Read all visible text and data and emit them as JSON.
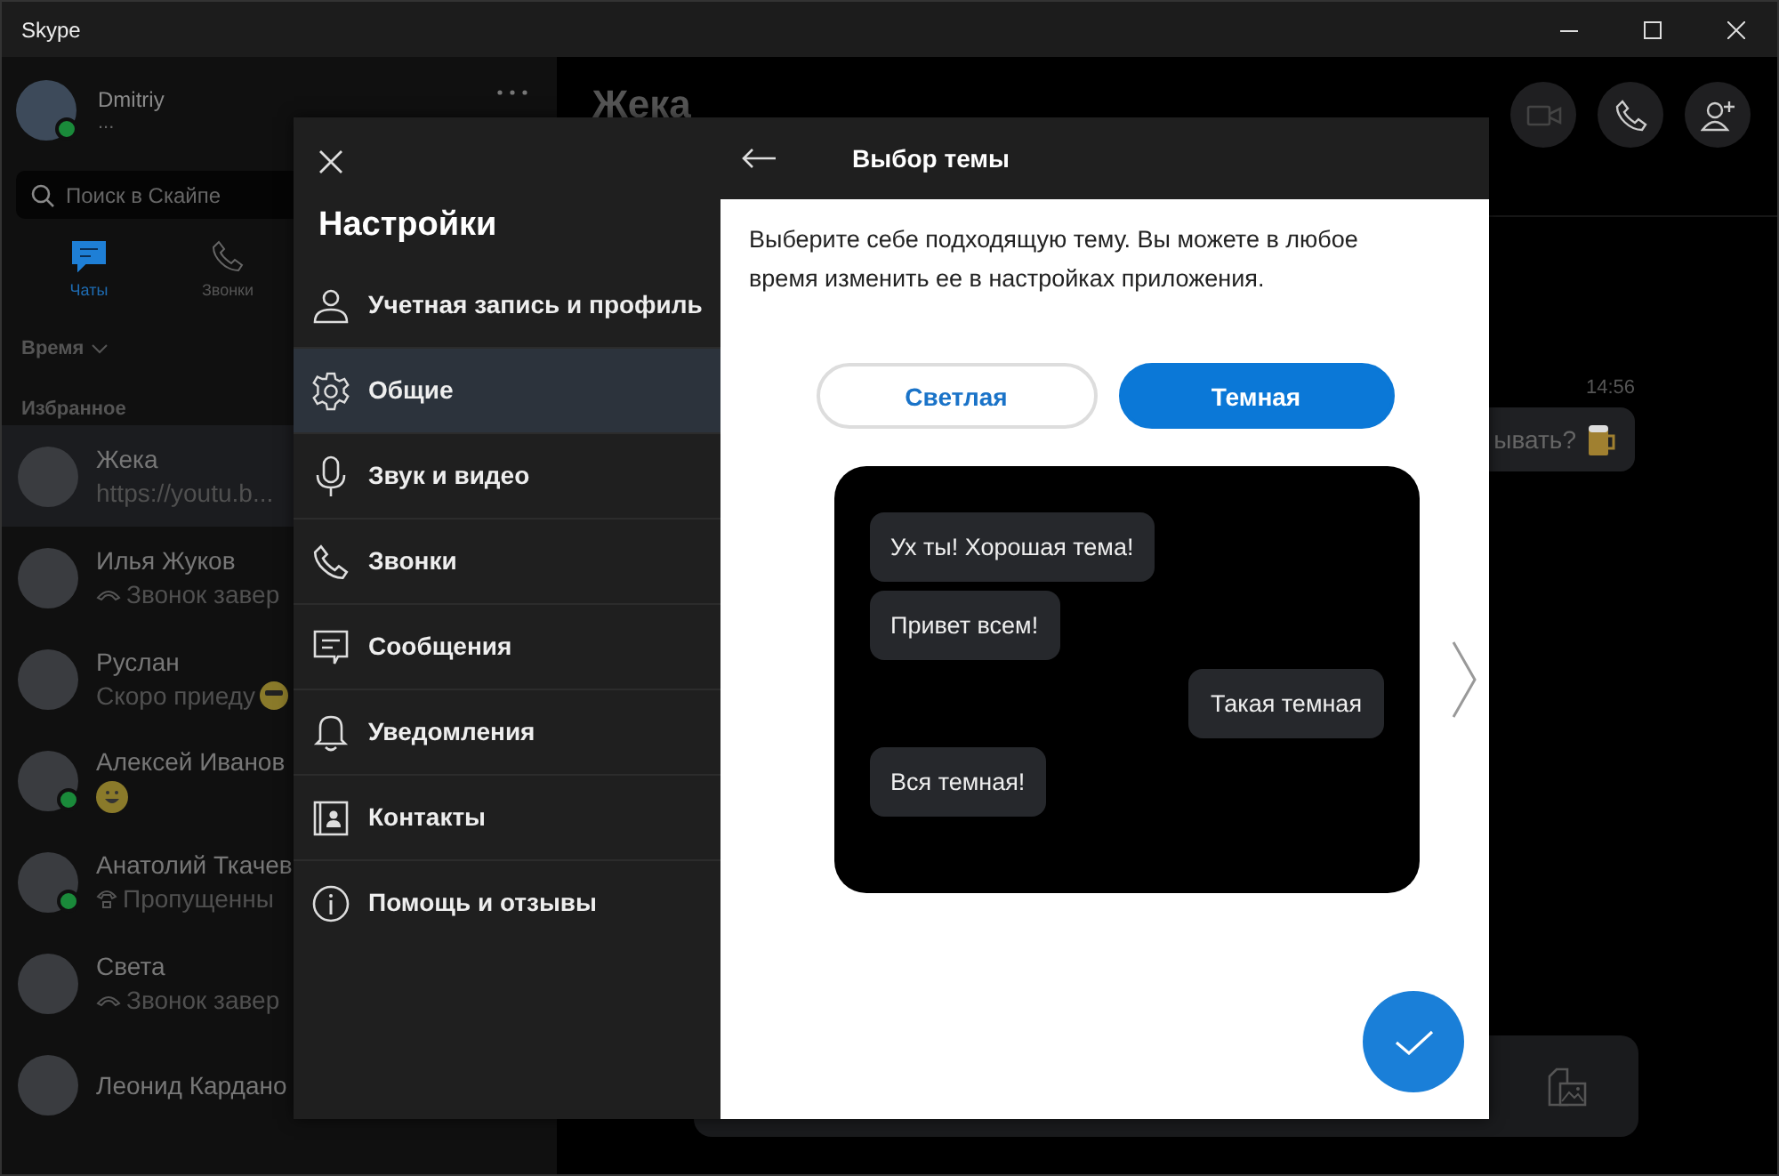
{
  "window": {
    "title": "Skype"
  },
  "profile": {
    "name": "Dmitriy",
    "status": "...",
    "online": true
  },
  "search": {
    "placeholder": "Поиск в Скайпе"
  },
  "nav_tabs": [
    {
      "label": "Чаты",
      "selected": true
    },
    {
      "label": "Звонки",
      "selected": false
    }
  ],
  "sort": {
    "label": "Время"
  },
  "section": "Избранное",
  "contacts": [
    {
      "name": "Жека",
      "preview": "https://youtu.b...",
      "kind": "text",
      "online": false,
      "selected": true
    },
    {
      "name": "Илья Жуков",
      "preview": "Звонок завер",
      "kind": "call-ended",
      "online": false,
      "selected": false
    },
    {
      "name": "Руслан",
      "preview": "Скоро приеду",
      "kind": "text-emoji",
      "online": false,
      "selected": false
    },
    {
      "name": "Алексей Иванов",
      "kind": "emoji",
      "online": true,
      "selected": false
    },
    {
      "name": "Анатолий Ткачев",
      "preview": "Пропущенны",
      "kind": "missed-call",
      "online": true,
      "selected": false
    },
    {
      "name": "Света",
      "preview": "Звонок завер",
      "kind": "call-ended",
      "online": false,
      "selected": false
    },
    {
      "name": "Леонид Кардано",
      "kind": "none",
      "online": false,
      "selected": false
    }
  ],
  "chat": {
    "title": "Жека",
    "time": "14:56",
    "message": "ывать?"
  },
  "settings": {
    "title": "Настройки",
    "items": [
      {
        "label": "Учетная запись и профиль",
        "selected": false
      },
      {
        "label": "Общие",
        "selected": true
      },
      {
        "label": "Звук и видео",
        "selected": false
      },
      {
        "label": "Звонки",
        "selected": false
      },
      {
        "label": "Сообщения",
        "selected": false
      },
      {
        "label": "Уведомления",
        "selected": false
      },
      {
        "label": "Контакты",
        "selected": false
      },
      {
        "label": "Помощь и отзывы",
        "selected": false
      }
    ]
  },
  "theme_panel": {
    "title": "Выбор темы",
    "description": "Выберите себе подходящую тему. Вы можете в любое время изменить ее в настройках приложения.",
    "options": [
      {
        "label": "Светлая",
        "selected": false
      },
      {
        "label": "Темная",
        "selected": true
      }
    ],
    "preview_messages": [
      {
        "text": "Ух ты! Хорошая тема!",
        "kind": "incoming"
      },
      {
        "text": "Привет всем!",
        "kind": "incoming"
      },
      {
        "text": "Такая темная",
        "kind": "outgoing"
      },
      {
        "text": "Вся темная!",
        "kind": "incoming"
      }
    ]
  }
}
